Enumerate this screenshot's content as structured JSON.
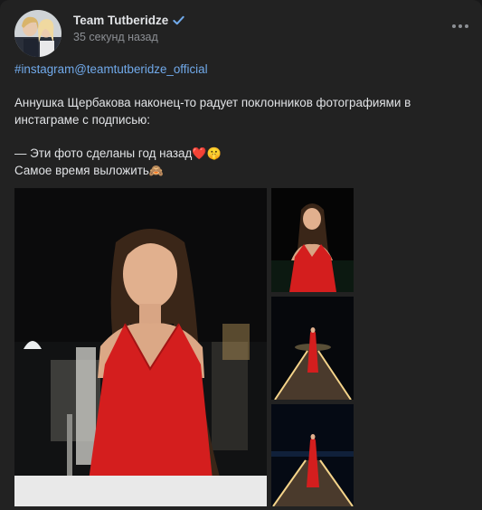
{
  "post": {
    "author": "Team Tutberidze",
    "time": "35 секунд назад",
    "hashtag": "#instagram@teamtutberidze_official",
    "paragraph1": "Аннушка Щербакова наконец-то радует поклонников фотографиями в инстаграме с подписью:",
    "quote_line1": "— Эти фото сделаны год назад",
    "quote_line1_emojis": "❤️🤫",
    "quote_line2": "Самое время выложить",
    "quote_line2_emoji": "🙈"
  },
  "icons": {
    "verified": "verified-check-icon",
    "more": "more-dots-icon"
  },
  "colors": {
    "background": "#222222",
    "text": "#e1e3e6",
    "secondary_text": "#8c8f94",
    "link": "#71aaeb",
    "verified": "#71aaeb",
    "dress_red": "#d41e1e"
  }
}
